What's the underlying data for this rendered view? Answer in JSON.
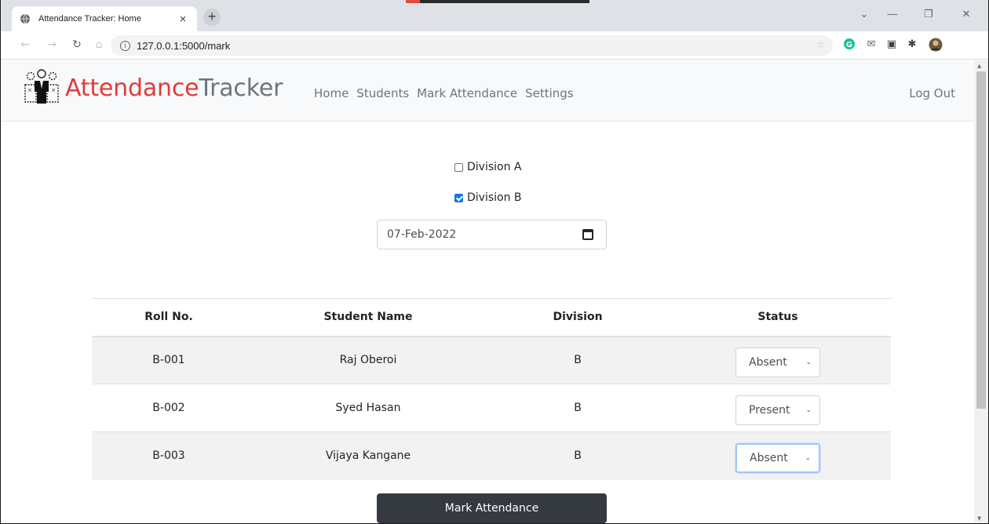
{
  "browser": {
    "tab_title": "Attendance Tracker: Home",
    "tab_close": "×",
    "new_tab": "+",
    "url": "127.0.0.1:5000/mark",
    "window_controls": [
      "⌄",
      "—",
      "❐",
      "✕"
    ]
  },
  "navbar": {
    "brand_part1": "Attendance",
    "brand_part2": "Tracker",
    "links": [
      "Home",
      "Students",
      "Mark Attendance",
      "Settings"
    ],
    "logout": "Log Out",
    "brand_colors": {
      "accent": "#e03b3b",
      "muted": "#6c757d"
    }
  },
  "filters": {
    "divisions": [
      {
        "label": "Division A",
        "checked": false
      },
      {
        "label": "Division B",
        "checked": true
      }
    ],
    "date_value": "07-Feb-2022"
  },
  "table": {
    "headers": [
      "Roll No.",
      "Student Name",
      "Division",
      "Status"
    ],
    "rows": [
      {
        "roll": "B-001",
        "name": "Raj Oberoi",
        "division": "B",
        "status": "Absent"
      },
      {
        "roll": "B-002",
        "name": "Syed Hasan",
        "division": "B",
        "status": "Present"
      },
      {
        "roll": "B-003",
        "name": "Vijaya Kangane",
        "division": "B",
        "status": "Absent"
      }
    ]
  },
  "submit_label": "Mark Attendance",
  "icons": {
    "tab_favicon": "globe-icon",
    "calendar": "calendar-icon",
    "select_arrow": "chevron-down-icon"
  }
}
